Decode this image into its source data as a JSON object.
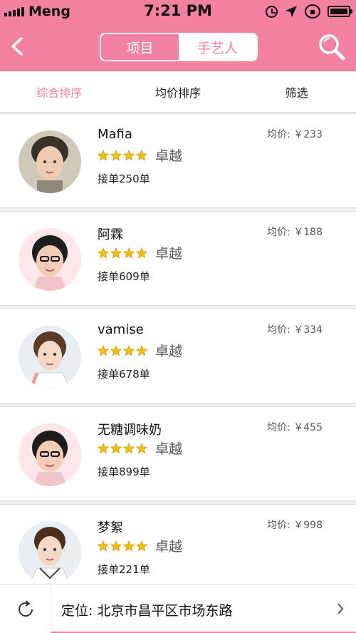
{
  "status_bar": {
    "carrier": "Meng",
    "time": "7:21 PM",
    "icons": [
      "signal-icon",
      "alarm-icon",
      "location-arrow-icon",
      "rotation-lock-icon",
      "battery-icon"
    ]
  },
  "nav": {
    "back_icon": "back-arrow-icon",
    "tabs": [
      {
        "label": "项目",
        "selected": false
      },
      {
        "label": "手艺人",
        "selected": true
      }
    ],
    "search_icon": "search-icon"
  },
  "sort_tabs": [
    {
      "label": "综合排序",
      "active": true
    },
    {
      "label": "均价排序",
      "active": false
    },
    {
      "label": "筛选",
      "active": false
    }
  ],
  "artists": [
    {
      "name": "Mafia",
      "price": "均价: ￥233",
      "stars": 4,
      "level": "卓越",
      "orders": "接单250单"
    },
    {
      "name": "阿霖",
      "price": "均价: ￥188",
      "stars": 4,
      "level": "卓越",
      "orders": "接单609单"
    },
    {
      "name": "vamise",
      "price": "均价: ￥334",
      "stars": 4,
      "level": "卓越",
      "orders": "接单678单"
    },
    {
      "name": "无糖调味奶",
      "price": "均价: ￥455",
      "stars": 4,
      "level": "卓越",
      "orders": "接单899单"
    },
    {
      "name": "梦絮",
      "price": "均价: ￥998",
      "stars": 4,
      "level": "卓越",
      "orders": "接单221单"
    }
  ],
  "location": {
    "text": "定位: 北京市昌平区市场东路",
    "refresh_icon": "refresh-icon",
    "chevron_icon": "chevron-right-icon"
  },
  "colors": {
    "accent": "#f4819f",
    "star": "#f5c000"
  }
}
